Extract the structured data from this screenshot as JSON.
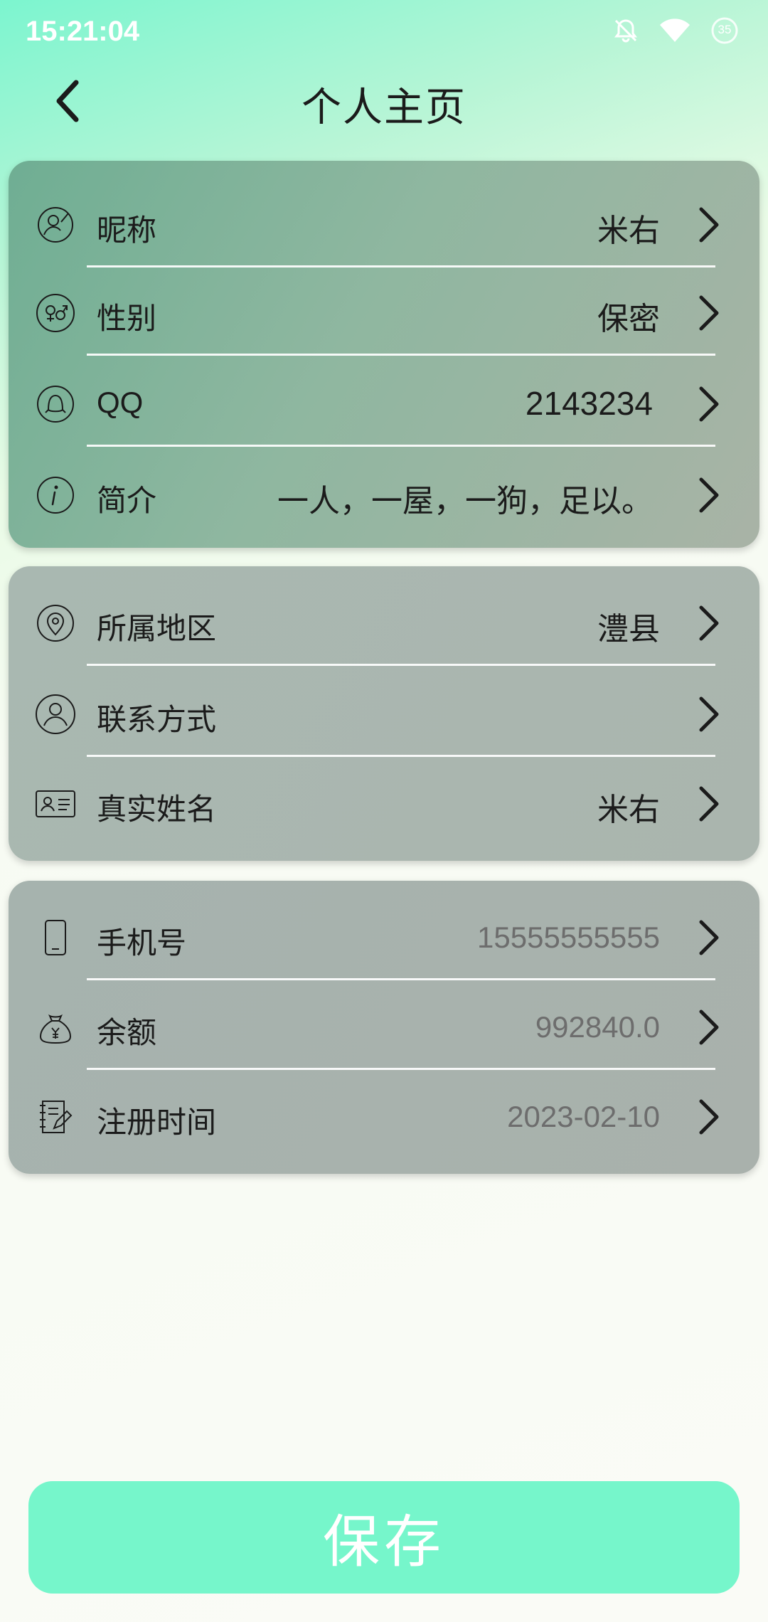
{
  "status_bar": {
    "time": "15:21:04",
    "icons": [
      "bell-off-icon",
      "wifi-icon",
      "battery-icon"
    ],
    "battery_level": "35"
  },
  "header": {
    "title": "个人主页",
    "back_icon": "chevron-left-icon"
  },
  "groups": [
    {
      "rows": [
        {
          "icon": "nickname-icon",
          "label": "昵称",
          "value": "米右"
        },
        {
          "icon": "gender-icon",
          "label": "性别",
          "value": "保密"
        },
        {
          "icon": "qq-icon",
          "label": "QQ",
          "value": "2143234"
        },
        {
          "icon": "info-icon",
          "label": "简介",
          "value": "一人，一屋，一狗，足以。"
        }
      ]
    },
    {
      "rows": [
        {
          "icon": "location-icon",
          "label": "所属地区",
          "value": "澧县"
        },
        {
          "icon": "contact-icon",
          "label": "联系方式",
          "value": ""
        },
        {
          "icon": "id-card-icon",
          "label": "真实姓名",
          "value": "米右"
        }
      ]
    },
    {
      "rows": [
        {
          "icon": "phone-icon",
          "label": "手机号",
          "value": "15555555555"
        },
        {
          "icon": "money-bag-icon",
          "label": "余额",
          "value": "992840.0"
        },
        {
          "icon": "register-note-icon",
          "label": "注册时间",
          "value": "2023-02-10"
        }
      ]
    }
  ],
  "save_button": {
    "label": "保存"
  },
  "colors": {
    "accent": "#76f6cb",
    "card1": "#8fb7a0",
    "card_gray": "#aab5ae",
    "muted_text": "#6d6d6d"
  }
}
